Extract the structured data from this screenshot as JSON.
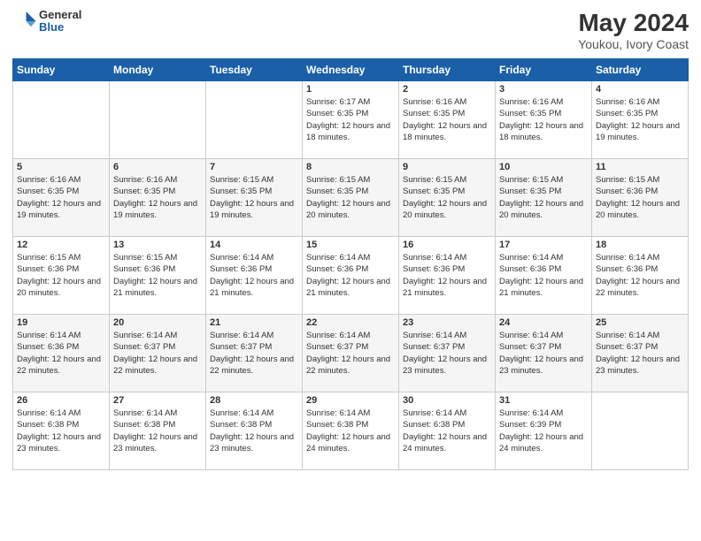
{
  "header": {
    "logo_general": "General",
    "logo_blue": "Blue",
    "title": "May 2024",
    "location": "Youkou, Ivory Coast"
  },
  "days_of_week": [
    "Sunday",
    "Monday",
    "Tuesday",
    "Wednesday",
    "Thursday",
    "Friday",
    "Saturday"
  ],
  "weeks": [
    [
      {
        "day": "",
        "info": ""
      },
      {
        "day": "",
        "info": ""
      },
      {
        "day": "",
        "info": ""
      },
      {
        "day": "1",
        "info": "Sunrise: 6:17 AM\nSunset: 6:35 PM\nDaylight: 12 hours and 18 minutes."
      },
      {
        "day": "2",
        "info": "Sunrise: 6:16 AM\nSunset: 6:35 PM\nDaylight: 12 hours and 18 minutes."
      },
      {
        "day": "3",
        "info": "Sunrise: 6:16 AM\nSunset: 6:35 PM\nDaylight: 12 hours and 18 minutes."
      },
      {
        "day": "4",
        "info": "Sunrise: 6:16 AM\nSunset: 6:35 PM\nDaylight: 12 hours and 19 minutes."
      }
    ],
    [
      {
        "day": "5",
        "info": "Sunrise: 6:16 AM\nSunset: 6:35 PM\nDaylight: 12 hours and 19 minutes."
      },
      {
        "day": "6",
        "info": "Sunrise: 6:16 AM\nSunset: 6:35 PM\nDaylight: 12 hours and 19 minutes."
      },
      {
        "day": "7",
        "info": "Sunrise: 6:15 AM\nSunset: 6:35 PM\nDaylight: 12 hours and 19 minutes."
      },
      {
        "day": "8",
        "info": "Sunrise: 6:15 AM\nSunset: 6:35 PM\nDaylight: 12 hours and 20 minutes."
      },
      {
        "day": "9",
        "info": "Sunrise: 6:15 AM\nSunset: 6:35 PM\nDaylight: 12 hours and 20 minutes."
      },
      {
        "day": "10",
        "info": "Sunrise: 6:15 AM\nSunset: 6:35 PM\nDaylight: 12 hours and 20 minutes."
      },
      {
        "day": "11",
        "info": "Sunrise: 6:15 AM\nSunset: 6:36 PM\nDaylight: 12 hours and 20 minutes."
      }
    ],
    [
      {
        "day": "12",
        "info": "Sunrise: 6:15 AM\nSunset: 6:36 PM\nDaylight: 12 hours and 20 minutes."
      },
      {
        "day": "13",
        "info": "Sunrise: 6:15 AM\nSunset: 6:36 PM\nDaylight: 12 hours and 21 minutes."
      },
      {
        "day": "14",
        "info": "Sunrise: 6:14 AM\nSunset: 6:36 PM\nDaylight: 12 hours and 21 minutes."
      },
      {
        "day": "15",
        "info": "Sunrise: 6:14 AM\nSunset: 6:36 PM\nDaylight: 12 hours and 21 minutes."
      },
      {
        "day": "16",
        "info": "Sunrise: 6:14 AM\nSunset: 6:36 PM\nDaylight: 12 hours and 21 minutes."
      },
      {
        "day": "17",
        "info": "Sunrise: 6:14 AM\nSunset: 6:36 PM\nDaylight: 12 hours and 21 minutes."
      },
      {
        "day": "18",
        "info": "Sunrise: 6:14 AM\nSunset: 6:36 PM\nDaylight: 12 hours and 22 minutes."
      }
    ],
    [
      {
        "day": "19",
        "info": "Sunrise: 6:14 AM\nSunset: 6:36 PM\nDaylight: 12 hours and 22 minutes."
      },
      {
        "day": "20",
        "info": "Sunrise: 6:14 AM\nSunset: 6:37 PM\nDaylight: 12 hours and 22 minutes."
      },
      {
        "day": "21",
        "info": "Sunrise: 6:14 AM\nSunset: 6:37 PM\nDaylight: 12 hours and 22 minutes."
      },
      {
        "day": "22",
        "info": "Sunrise: 6:14 AM\nSunset: 6:37 PM\nDaylight: 12 hours and 22 minutes."
      },
      {
        "day": "23",
        "info": "Sunrise: 6:14 AM\nSunset: 6:37 PM\nDaylight: 12 hours and 23 minutes."
      },
      {
        "day": "24",
        "info": "Sunrise: 6:14 AM\nSunset: 6:37 PM\nDaylight: 12 hours and 23 minutes."
      },
      {
        "day": "25",
        "info": "Sunrise: 6:14 AM\nSunset: 6:37 PM\nDaylight: 12 hours and 23 minutes."
      }
    ],
    [
      {
        "day": "26",
        "info": "Sunrise: 6:14 AM\nSunset: 6:38 PM\nDaylight: 12 hours and 23 minutes."
      },
      {
        "day": "27",
        "info": "Sunrise: 6:14 AM\nSunset: 6:38 PM\nDaylight: 12 hours and 23 minutes."
      },
      {
        "day": "28",
        "info": "Sunrise: 6:14 AM\nSunset: 6:38 PM\nDaylight: 12 hours and 23 minutes."
      },
      {
        "day": "29",
        "info": "Sunrise: 6:14 AM\nSunset: 6:38 PM\nDaylight: 12 hours and 24 minutes."
      },
      {
        "day": "30",
        "info": "Sunrise: 6:14 AM\nSunset: 6:38 PM\nDaylight: 12 hours and 24 minutes."
      },
      {
        "day": "31",
        "info": "Sunrise: 6:14 AM\nSunset: 6:39 PM\nDaylight: 12 hours and 24 minutes."
      },
      {
        "day": "",
        "info": ""
      }
    ]
  ]
}
